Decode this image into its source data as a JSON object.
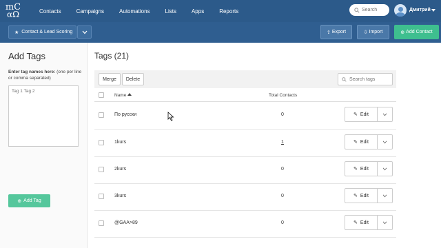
{
  "nav": {
    "logo_top": "mC",
    "logo_bottom": "αΩ",
    "items": [
      {
        "label": "Contacts"
      },
      {
        "label": "Campaigns"
      },
      {
        "label": "Automations"
      },
      {
        "label": "Lists"
      },
      {
        "label": "Apps"
      },
      {
        "label": "Reports"
      }
    ],
    "search_placeholder": "Search",
    "username": "Дмитрий"
  },
  "subbar": {
    "scoring_label": "Contact & Lead Scoring",
    "export_label": "Export",
    "import_label": "Import",
    "add_contact_label": "Add Contact"
  },
  "left": {
    "title": "Add Tags",
    "help_bold": "Enter tag names here:",
    "help_rest": " (one per line or comma separated)",
    "textarea_placeholder": "Tag 1 Tag 2",
    "add_tag_label": "Add Tag"
  },
  "main": {
    "title": "Tags (21)",
    "merge_label": "Merge",
    "delete_label": "Delete",
    "search_placeholder": "Search tags",
    "col_name": "Name",
    "col_total": "Total Contacts",
    "edit_label": "Edit",
    "rows": [
      {
        "name": "По руcски",
        "count": "0"
      },
      {
        "name": "1kurs",
        "count": "1"
      },
      {
        "name": "2kurs",
        "count": "0"
      },
      {
        "name": "3kurs",
        "count": "0"
      },
      {
        "name": "@GAA>89",
        "count": "0"
      }
    ]
  },
  "colors": {
    "nav_bg": "#2c5a8a",
    "subbar_bg": "#2f5e90",
    "add_contact_green": "#3ebf8f",
    "add_tag_green": "#55c79c"
  }
}
